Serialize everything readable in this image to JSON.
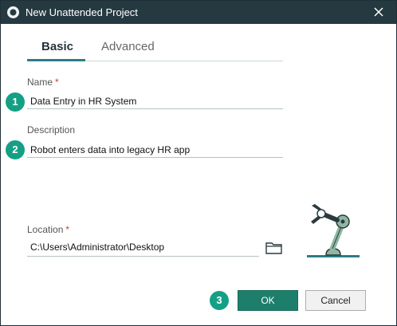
{
  "window": {
    "title": "New Unattended Project",
    "app_icon": "uipath-circle-icon",
    "close_icon": "close-x-icon"
  },
  "tabs": [
    {
      "label": "Basic",
      "active": true
    },
    {
      "label": "Advanced",
      "active": false
    }
  ],
  "form": {
    "name": {
      "label": "Name",
      "required_mark": "*",
      "value": "Data Entry in HR System"
    },
    "description": {
      "label": "Description",
      "value": "Robot enters data into legacy HR app"
    },
    "location": {
      "label": "Location",
      "required_mark": "*",
      "value": "C:\\Users\\Administrator\\Desktop",
      "browse_icon": "folder-icon"
    }
  },
  "callouts": [
    "1",
    "2",
    "3"
  ],
  "buttons": {
    "ok": "OK",
    "cancel": "Cancel"
  },
  "illustration": "robot-arm-icon",
  "colors": {
    "titlebar": "#253940",
    "accent": "#2f7c8a",
    "badge": "#14a085",
    "ok_button": "#1d7f6b"
  }
}
